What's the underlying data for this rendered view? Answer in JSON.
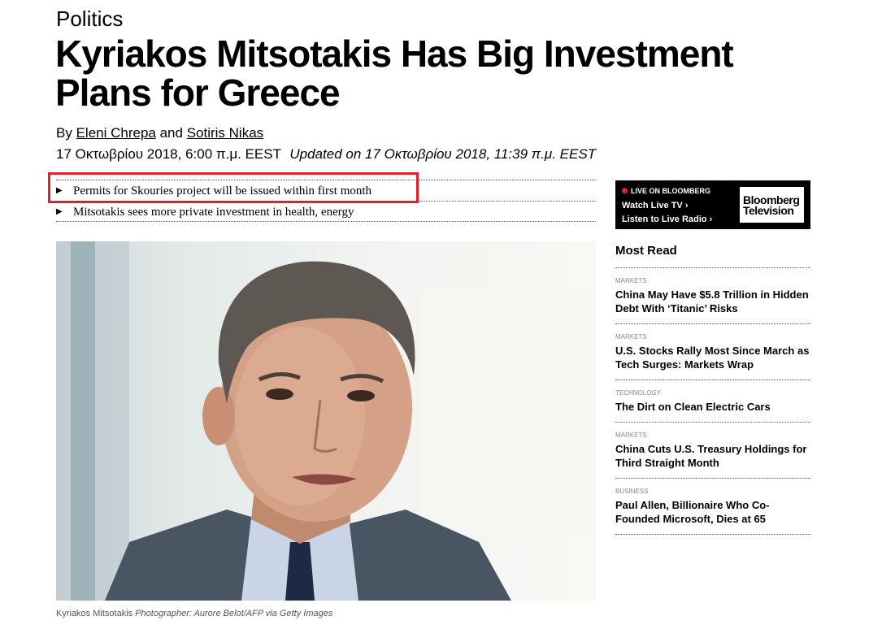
{
  "article": {
    "category": "Politics",
    "headline_line1": "Kyriakos Mitsotakis Has Big Investment",
    "headline_line2": "Plans for Greece",
    "byline_prefix": "By",
    "author1": "Eleni Chrepa",
    "byline_and": "and",
    "author2": "Sotiris Nikas",
    "published": "17 Οκτωβρίου 2018, 6:00 π.μ. EEST",
    "updated": "Updated on 17 Οκτωβρίου 2018, 11:39 π.μ. EEST",
    "bullets": [
      "Permits for Skouries project will be issued within first month",
      "Mitsotakis sees more private investment in health, energy"
    ],
    "caption_subject": "Kyriakos Mitsotakis",
    "caption_credit": "Photographer: Aurore Belot/AFP via Getty Images"
  },
  "sidebar": {
    "live": {
      "label": "LIVE ON BLOOMBERG",
      "watch": "Watch Live TV",
      "listen": "Listen to Live Radio",
      "logo_line1": "Bloomberg",
      "logo_line2": "Television"
    },
    "most_read": {
      "heading": "Most Read",
      "items": [
        {
          "category": "MARKETS",
          "title": "China May Have $5.8 Trillion in Hidden Debt With ‘Titanic’ Risks"
        },
        {
          "category": "MARKETS",
          "title": "U.S. Stocks Rally Most Since March as Tech Surges: Markets Wrap"
        },
        {
          "category": "TECHNOLOGY",
          "title": "The Dirt on Clean Electric Cars"
        },
        {
          "category": "MARKETS",
          "title": "China Cuts U.S. Treasury Holdings for Third Straight Month"
        },
        {
          "category": "BUSINESS",
          "title": "Paul Allen, Billionaire Who Co-Founded Microsoft, Dies at 65"
        }
      ]
    }
  },
  "colors": {
    "highlight": "#e0202a",
    "live_bg": "#000000"
  }
}
